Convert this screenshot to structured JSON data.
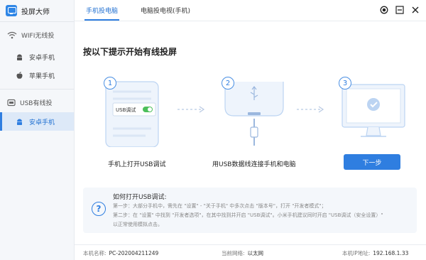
{
  "app": {
    "title": "投屏大师"
  },
  "sidebar": {
    "groups": [
      {
        "label": "WIFI无线投",
        "icon": "wifi-icon",
        "items": [
          {
            "label": "安卓手机",
            "icon": "android-icon",
            "active": false
          },
          {
            "label": "苹果手机",
            "icon": "apple-icon",
            "active": false
          }
        ]
      },
      {
        "label": "USB有线投",
        "icon": "usb-icon",
        "items": [
          {
            "label": "安卓手机",
            "icon": "android-icon",
            "active": true
          }
        ]
      }
    ]
  },
  "tabs": [
    {
      "label": "手机投电脑",
      "active": true
    },
    {
      "label": "电脑投电视(手机)",
      "active": false
    }
  ],
  "window_controls": [
    "record-icon",
    "minimize-icon",
    "close-icon"
  ],
  "main": {
    "heading": "按以下提示开始有线投屏",
    "steps": [
      {
        "num": "1",
        "label": "手机上打开USB调试",
        "toggle_label": "USB调试"
      },
      {
        "num": "2",
        "label": "用USB数据线连接手机和电脑"
      },
      {
        "num": "3",
        "label": ""
      }
    ],
    "next_button": "下一步"
  },
  "help": {
    "title": "如何打开USB调试:",
    "lines": [
      "第一步：大部分手机中，需先在 \"设置\" - \"关于手机\" 中多次点击 \"版本号\"，打开 \"开发者模式\"；",
      "第二步：在 \"设置\" 中找到 \"开发者选项\"，在其中找到并开启 \"USB调试\"。小米手机建议同时开启 \"USB调试（安全设置）\"",
      "以正常使用模拟点击。"
    ]
  },
  "status": {
    "machine_label": "本机名称:",
    "machine_value": "PC-202004211249",
    "network_label": "当前网络:",
    "network_value": "以太网",
    "ip_label": "本机IP地址:",
    "ip_value": "192.168.1.33"
  },
  "colors": {
    "accent": "#2f7ee0",
    "sidebar_bg": "#f5f7fa",
    "active_bg": "#dde9f8"
  }
}
